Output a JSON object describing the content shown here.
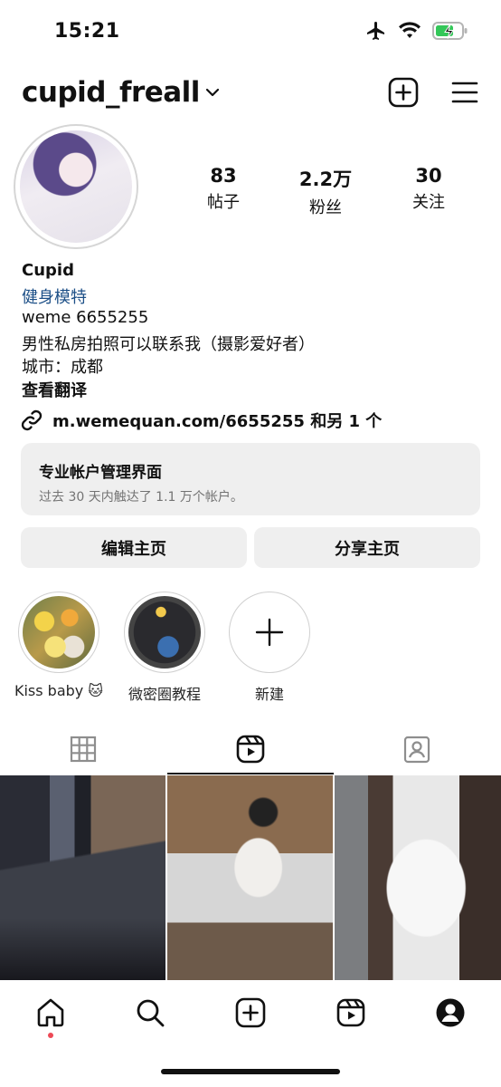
{
  "status_bar": {
    "time": "15:21"
  },
  "header": {
    "username": "cupid_freall"
  },
  "stats": [
    {
      "value": "83",
      "label": "帖子"
    },
    {
      "value": "2.2万",
      "label": "粉丝"
    },
    {
      "value": "30",
      "label": "关注"
    }
  ],
  "bio": {
    "name": "Cupid",
    "category": "健身模特",
    "line1": "weme 6655255",
    "line2": "男性私房拍照可以联系我（摄影爱好者）",
    "line3": "城市：成都",
    "translate": "查看翻译",
    "link": "m.wemequan.com/6655255 和另 1 个"
  },
  "dashboard": {
    "title": "专业帐户管理界面",
    "subtitle": "过去 30 天内触达了 1.1 万个帐户。"
  },
  "buttons": {
    "edit": "编辑主页",
    "share": "分享主页"
  },
  "highlights": [
    {
      "label": "Kiss baby 🐱"
    },
    {
      "label": "微密圈教程"
    },
    {
      "label": "新建"
    }
  ],
  "icons": {
    "tabs": [
      "grid-icon",
      "reels-icon",
      "tagged-icon"
    ],
    "nav": [
      "home-icon",
      "search-icon",
      "create-icon",
      "reels-icon",
      "profile-icon"
    ]
  },
  "colors": {
    "link_blue": "#1c4f87",
    "notification_dot": "#ed4956",
    "battery_green": "#34c759"
  }
}
